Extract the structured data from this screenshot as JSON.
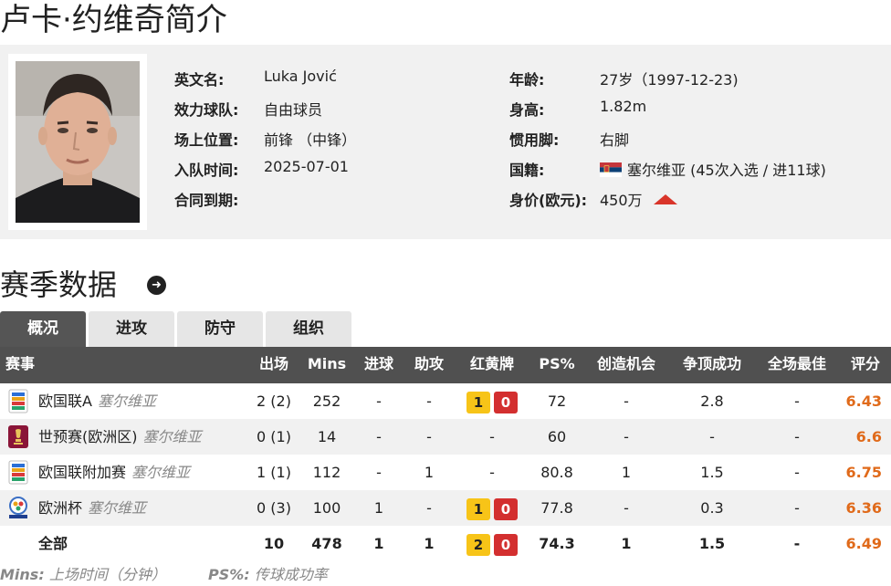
{
  "page_title": "卢卡·约维奇简介",
  "profile": {
    "fields_left": [
      {
        "label": "英文名:",
        "value": "Luka Jović"
      },
      {
        "label": "效力球队:",
        "value": "自由球员"
      },
      {
        "label": "场上位置:",
        "value": "前锋 （中锋）"
      },
      {
        "label": "入队时间:",
        "value": "2025-07-01"
      },
      {
        "label": "合同到期:",
        "value": ""
      }
    ],
    "age_label": "年龄:",
    "age_value": "27岁（1997-12-23)",
    "height_label": "身高:",
    "height_value": "1.82m",
    "foot_label": "惯用脚:",
    "foot_value": "右脚",
    "nationality_label": "国籍:",
    "nationality_value": "塞尔维亚 (45次入选 / 进11球)",
    "value_label": "身价(欧元):",
    "value_value": "450万",
    "value_trend_icon": "triangle-up-icon",
    "trend_color": "#d9352a"
  },
  "season_title": "赛季数据",
  "season_arrow_icon": "arrow-right-circle-icon",
  "tabs": [
    {
      "label": "概况",
      "active": true
    },
    {
      "label": "进攻",
      "active": false
    },
    {
      "label": "防守",
      "active": false
    },
    {
      "label": "组织",
      "active": false
    }
  ],
  "table": {
    "headers": [
      "赛事",
      "出场",
      "Mins",
      "进球",
      "助攻",
      "红黄牌",
      "PS%",
      "创造机会",
      "争顶成功",
      "全场最佳",
      "评分"
    ],
    "rows": [
      {
        "competition": "欧国联A",
        "team": "塞尔维亚",
        "icon": "nations-league-icon",
        "apps": "2 (2)",
        "mins": "252",
        "goals": "-",
        "assists": "-",
        "yellow": "1",
        "red": "0",
        "ps": "72",
        "chances": "-",
        "aerials": "2.8",
        "motm": "-",
        "rating": "6.43"
      },
      {
        "competition": "世预赛(欧洲区)",
        "team": "塞尔维亚",
        "icon": "world-cup-qualifier-icon",
        "apps": "0 (1)",
        "mins": "14",
        "goals": "-",
        "assists": "-",
        "cards_text": "-",
        "ps": "60",
        "chances": "-",
        "aerials": "-",
        "motm": "-",
        "rating": "6.6"
      },
      {
        "competition": "欧国联附加赛",
        "team": "塞尔维亚",
        "icon": "nations-league-icon",
        "apps": "1 (1)",
        "mins": "112",
        "goals": "-",
        "assists": "1",
        "cards_text": "-",
        "ps": "80.8",
        "chances": "1",
        "aerials": "1.5",
        "motm": "-",
        "rating": "6.75"
      },
      {
        "competition": "欧洲杯",
        "team": "塞尔维亚",
        "icon": "euro-cup-icon",
        "apps": "0 (3)",
        "mins": "100",
        "goals": "1",
        "assists": "-",
        "yellow": "1",
        "red": "0",
        "ps": "77.8",
        "chances": "-",
        "aerials": "0.3",
        "motm": "-",
        "rating": "6.36"
      }
    ],
    "total": {
      "competition": "全部",
      "apps": "10",
      "mins": "478",
      "goals": "1",
      "assists": "1",
      "yellow": "2",
      "red": "0",
      "ps": "74.3",
      "chances": "1",
      "aerials": "1.5",
      "motm": "-",
      "rating": "6.49"
    }
  },
  "footnotes": [
    {
      "key": "Mins:",
      "text": "上场时间（分钟）"
    },
    {
      "key": "PS%:",
      "text": "传球成功率"
    }
  ],
  "colors": {
    "rating": "#e06a1a",
    "yellow_card": "#f7c418",
    "red_card": "#d32f2f",
    "header_bg": "#505050"
  }
}
